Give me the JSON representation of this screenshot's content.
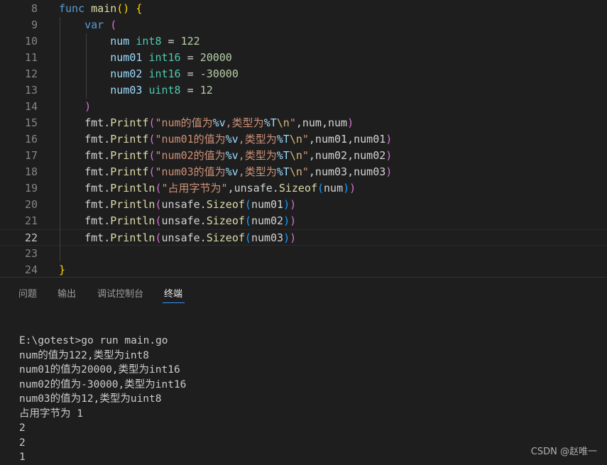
{
  "editor": {
    "lines": [
      {
        "n": "8",
        "tokens": [
          {
            "t": "func ",
            "c": "kw"
          },
          {
            "t": "main",
            "c": "fn"
          },
          {
            "t": "()",
            "c": "br1"
          },
          {
            "t": " ",
            "c": "plain"
          },
          {
            "t": "{",
            "c": "br1"
          }
        ]
      },
      {
        "n": "9",
        "tokens": [
          {
            "t": "    var ",
            "c": "kw"
          },
          {
            "t": "(",
            "c": "br2"
          }
        ]
      },
      {
        "n": "10",
        "tokens": [
          {
            "t": "        num ",
            "c": "var"
          },
          {
            "t": "int8",
            "c": "typ"
          },
          {
            "t": " = ",
            "c": "plain"
          },
          {
            "t": "122",
            "c": "num"
          }
        ]
      },
      {
        "n": "11",
        "tokens": [
          {
            "t": "        num01 ",
            "c": "var"
          },
          {
            "t": "int16",
            "c": "typ"
          },
          {
            "t": " = ",
            "c": "plain"
          },
          {
            "t": "20000",
            "c": "num"
          }
        ]
      },
      {
        "n": "12",
        "tokens": [
          {
            "t": "        num02 ",
            "c": "var"
          },
          {
            "t": "int16",
            "c": "typ"
          },
          {
            "t": " = ",
            "c": "plain"
          },
          {
            "t": "-30000",
            "c": "num"
          }
        ]
      },
      {
        "n": "13",
        "tokens": [
          {
            "t": "        num03 ",
            "c": "var"
          },
          {
            "t": "uint8",
            "c": "typ"
          },
          {
            "t": " = ",
            "c": "plain"
          },
          {
            "t": "12",
            "c": "num"
          }
        ]
      },
      {
        "n": "14",
        "tokens": [
          {
            "t": "    ",
            "c": "plain"
          },
          {
            "t": ")",
            "c": "br2"
          }
        ]
      },
      {
        "n": "15",
        "tokens": [
          {
            "t": "    fmt.",
            "c": "plain"
          },
          {
            "t": "Printf",
            "c": "fn"
          },
          {
            "t": "(",
            "c": "br2"
          },
          {
            "t": "\"num的值为",
            "c": "str"
          },
          {
            "t": "%v",
            "c": "fmt"
          },
          {
            "t": ",类型为",
            "c": "str"
          },
          {
            "t": "%T",
            "c": "fmt"
          },
          {
            "t": "\\n",
            "c": "esc"
          },
          {
            "t": "\"",
            "c": "str"
          },
          {
            "t": ",num,num",
            "c": "plain"
          },
          {
            "t": ")",
            "c": "br2"
          }
        ]
      },
      {
        "n": "16",
        "tokens": [
          {
            "t": "    fmt.",
            "c": "plain"
          },
          {
            "t": "Printf",
            "c": "fn"
          },
          {
            "t": "(",
            "c": "br2"
          },
          {
            "t": "\"num01的值为",
            "c": "str"
          },
          {
            "t": "%v",
            "c": "fmt"
          },
          {
            "t": ",类型为",
            "c": "str"
          },
          {
            "t": "%T",
            "c": "fmt"
          },
          {
            "t": "\\n",
            "c": "esc"
          },
          {
            "t": "\"",
            "c": "str"
          },
          {
            "t": ",num01,num01",
            "c": "plain"
          },
          {
            "t": ")",
            "c": "br2"
          }
        ]
      },
      {
        "n": "17",
        "tokens": [
          {
            "t": "    fmt.",
            "c": "plain"
          },
          {
            "t": "Printf",
            "c": "fn"
          },
          {
            "t": "(",
            "c": "br2"
          },
          {
            "t": "\"num02的值为",
            "c": "str"
          },
          {
            "t": "%v",
            "c": "fmt"
          },
          {
            "t": ",类型为",
            "c": "str"
          },
          {
            "t": "%T",
            "c": "fmt"
          },
          {
            "t": "\\n",
            "c": "esc"
          },
          {
            "t": "\"",
            "c": "str"
          },
          {
            "t": ",num02,num02",
            "c": "plain"
          },
          {
            "t": ")",
            "c": "br2"
          }
        ]
      },
      {
        "n": "18",
        "tokens": [
          {
            "t": "    fmt.",
            "c": "plain"
          },
          {
            "t": "Printf",
            "c": "fn"
          },
          {
            "t": "(",
            "c": "br2"
          },
          {
            "t": "\"num03的值为",
            "c": "str"
          },
          {
            "t": "%v",
            "c": "fmt"
          },
          {
            "t": ",类型为",
            "c": "str"
          },
          {
            "t": "%T",
            "c": "fmt"
          },
          {
            "t": "\\n",
            "c": "esc"
          },
          {
            "t": "\"",
            "c": "str"
          },
          {
            "t": ",num03,num03",
            "c": "plain"
          },
          {
            "t": ")",
            "c": "br2"
          }
        ]
      },
      {
        "n": "19",
        "tokens": [
          {
            "t": "    fmt.",
            "c": "plain"
          },
          {
            "t": "Println",
            "c": "fn"
          },
          {
            "t": "(",
            "c": "br2"
          },
          {
            "t": "\"占用字节为\"",
            "c": "str"
          },
          {
            "t": ",unsafe.",
            "c": "plain"
          },
          {
            "t": "Sizeof",
            "c": "fn"
          },
          {
            "t": "(",
            "c": "br3"
          },
          {
            "t": "num",
            "c": "plain"
          },
          {
            "t": ")",
            "c": "br3"
          },
          {
            "t": ")",
            "c": "br2"
          }
        ]
      },
      {
        "n": "20",
        "tokens": [
          {
            "t": "    fmt.",
            "c": "plain"
          },
          {
            "t": "Println",
            "c": "fn"
          },
          {
            "t": "(",
            "c": "br2"
          },
          {
            "t": "unsafe.",
            "c": "plain"
          },
          {
            "t": "Sizeof",
            "c": "fn"
          },
          {
            "t": "(",
            "c": "br3"
          },
          {
            "t": "num01",
            "c": "plain"
          },
          {
            "t": ")",
            "c": "br3"
          },
          {
            "t": ")",
            "c": "br2"
          }
        ]
      },
      {
        "n": "21",
        "tokens": [
          {
            "t": "    fmt.",
            "c": "plain"
          },
          {
            "t": "Println",
            "c": "fn"
          },
          {
            "t": "(",
            "c": "br2"
          },
          {
            "t": "unsafe.",
            "c": "plain"
          },
          {
            "t": "Sizeof",
            "c": "fn"
          },
          {
            "t": "(",
            "c": "br3"
          },
          {
            "t": "num02",
            "c": "plain"
          },
          {
            "t": ")",
            "c": "br3"
          },
          {
            "t": ")",
            "c": "br2"
          }
        ]
      },
      {
        "n": "22",
        "tokens": [
          {
            "t": "    fmt.",
            "c": "plain"
          },
          {
            "t": "Println",
            "c": "fn"
          },
          {
            "t": "(",
            "c": "br2"
          },
          {
            "t": "unsafe.",
            "c": "plain"
          },
          {
            "t": "Sizeof",
            "c": "fn"
          },
          {
            "t": "(",
            "c": "br3"
          },
          {
            "t": "num03",
            "c": "plain"
          },
          {
            "t": ")",
            "c": "br3"
          },
          {
            "t": ")",
            "c": "br2"
          }
        ]
      },
      {
        "n": "23",
        "tokens": []
      },
      {
        "n": "24",
        "tokens": [
          {
            "t": "}",
            "c": "br1"
          }
        ]
      }
    ],
    "active_line": "22"
  },
  "panel": {
    "tabs": [
      {
        "label": "问题",
        "active": false
      },
      {
        "label": "输出",
        "active": false
      },
      {
        "label": "调试控制台",
        "active": false
      },
      {
        "label": "终端",
        "active": true
      }
    ]
  },
  "terminal": {
    "lines": [
      "E:\\gotest>go run main.go",
      "num的值为122,类型为int8",
      "num01的值为20000,类型为int16",
      "num02的值为-30000,类型为int16",
      "num03的值为12,类型为uint8",
      "占用字节为 1",
      "2",
      "2",
      "1"
    ]
  },
  "watermark": "CSDN @赵唯一"
}
